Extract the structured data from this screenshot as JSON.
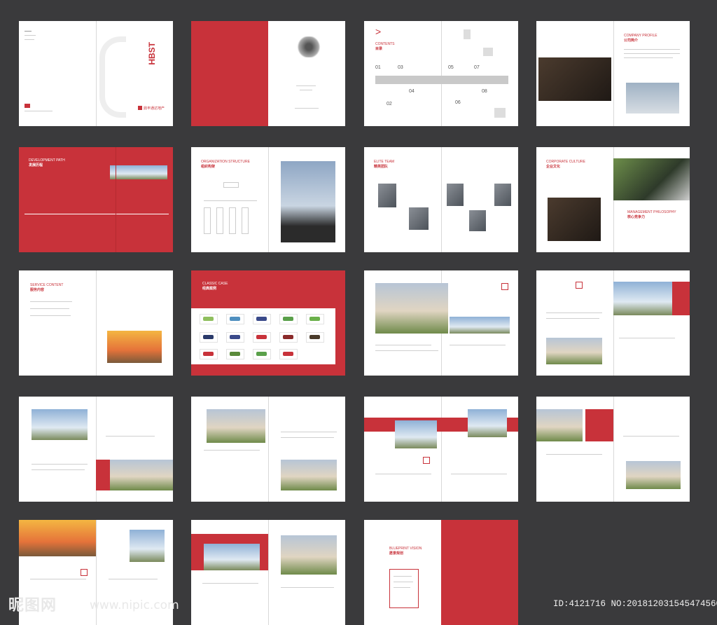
{
  "colors": {
    "background": "#3a3a3c",
    "brand_red": "#c8323a",
    "page": "#ffffff"
  },
  "cover": {
    "vertical_logo": "HBST",
    "brand_line": "鼎丰通达地产"
  },
  "contents": {
    "en": "CONTENTS",
    "cn": "目录",
    "numbers": [
      "01",
      "02",
      "03",
      "04",
      "05",
      "06",
      "07",
      "08"
    ]
  },
  "company_profile": {
    "en": "COMPANY PROFILE",
    "cn": "公司简介"
  },
  "development_path": {
    "en": "DEVELOPMENT PATH",
    "cn": "发展历程"
  },
  "organization": {
    "en": "ORGANIZATION STRUCTURE",
    "cn": "组织构架"
  },
  "elite_team": {
    "en": "ELITE TEAM",
    "cn": "精英团队"
  },
  "corporate_culture": {
    "en": "CORPORATE CULTURE",
    "cn": "企业文化"
  },
  "management": {
    "en": "MANAGEMENT PHILOSOPHY",
    "cn": "核心竞争力"
  },
  "service_content": {
    "en": "SERVICE CONTENT",
    "cn": "服务内容"
  },
  "classic_case": {
    "en": "CLASSIC CASE",
    "cn": "经典案例"
  },
  "blueprint": {
    "en": "BLUEPRINT VISION",
    "cn": "愿景规划"
  },
  "watermark": {
    "site": "昵图网",
    "url": "www.nipic.com"
  },
  "image_id": "ID:4121716 NO:20181203154547456084",
  "icons": [
    "chevron-right-icon",
    "pegasus-icon",
    "logo-icon"
  ]
}
